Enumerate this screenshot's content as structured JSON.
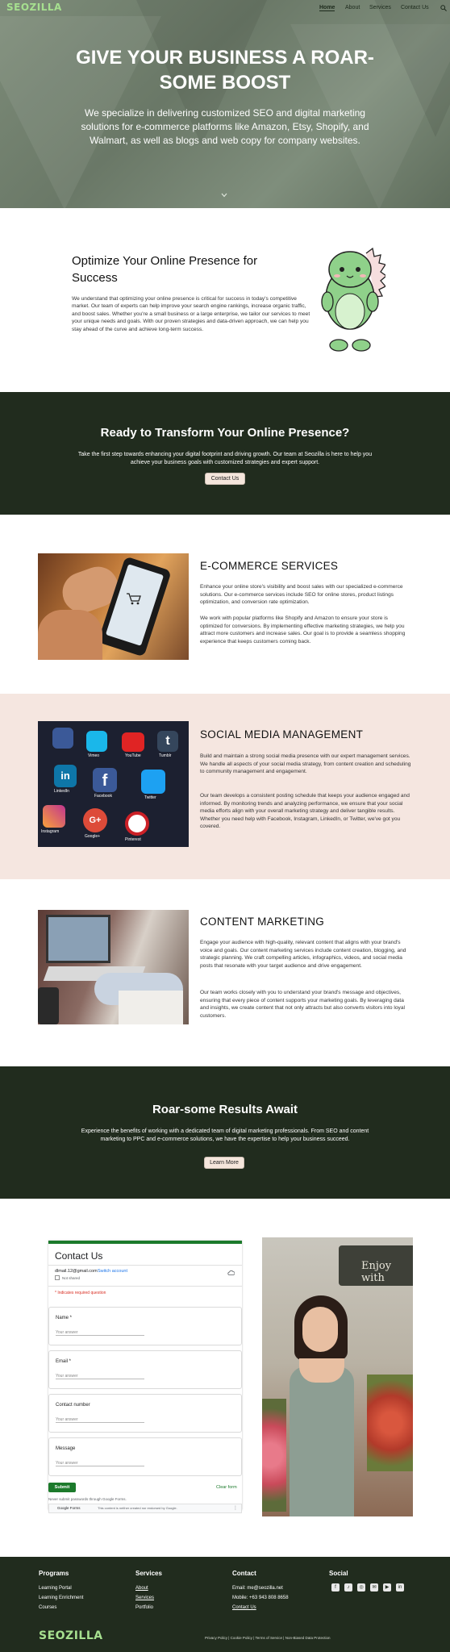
{
  "brand": {
    "logo_text": "SEOZILLA",
    "accent": "#a6e08f",
    "dark": "#212c1e",
    "cream": "#f5e6dc"
  },
  "nav": {
    "items": [
      "Home",
      "About",
      "Services",
      "Contact Us"
    ],
    "active": "Home",
    "search_icon": "search-icon"
  },
  "hero": {
    "title": "GIVE YOUR BUSINESS A ROAR-SOME BOOST",
    "subtitle": "We specialize in delivering customized SEO and digital marketing solutions for e-commerce platforms like Amazon, Etsy, Shopify, and Walmart, as well as blogs and web copy for company websites.",
    "scroll_icon": "chevron-down-icon"
  },
  "optimize": {
    "title": "Optimize Your Online Presence for Success",
    "text": "We understand that optimizing your online presence is critical for success in today's competitive market. Our team of experts can help improve your search engine rankings, increase organic traffic, and boost sales. Whether you're a small business or a large enterprise, we tailor our services to meet your unique needs and goals. With our proven strategies and data-driven approach, we can help you stay ahead of the curve and achieve long-term success."
  },
  "cta1": {
    "title": "Ready to Transform Your Online Presence?",
    "text": "Take the first step towards enhancing your digital footprint and driving growth. Our team at Seozilla is here to help you achieve your business goals with customized strategies and expert support.",
    "button": "Contact Us"
  },
  "services": [
    {
      "title": "E-COMMERCE SERVICES",
      "p1": "Enhance your online store's visibility and boost sales with our specialized e-commerce solutions. Our e-commerce services include SEO for online stores, product listings optimization, and conversion rate optimization.",
      "p2": "We work with popular platforms like Shopify and Amazon to ensure your store is optimized for conversions. By implementing effective marketing strategies, we help you attract more customers and increase sales. Our goal is to provide a seamless shopping experience that keeps customers coming back."
    },
    {
      "title": "SOCIAL MEDIA MANAGEMENT",
      "p1": "Build and maintain a strong social media presence with our expert management services. We handle all aspects of your social media strategy, from content creation and scheduling to community management and engagement.",
      "p2": "Our team develops a consistent posting schedule that keeps your audience engaged and informed. By monitoring trends and analyzing performance, we ensure that your social media efforts align with your overall marketing strategy and deliver tangible results. Whether you need help with Facebook, Instagram, LinkedIn, or Twitter, we've got you covered.",
      "app_labels": [
        "Vimeo",
        "YouTube",
        "Tumblr",
        "LinkedIn",
        "Facebook",
        "Twitter",
        "Instagram",
        "Google+",
        "Pinterest"
      ]
    },
    {
      "title": "CONTENT MARKETING",
      "p1": "Engage your audience with high-quality, relevant content that aligns with your brand's voice and goals. Our content marketing services include content creation, blogging, and strategic planning. We craft compelling articles, infographics, videos, and social media posts that resonate with your target audience and drive engagement.",
      "p2": "Our team works closely with you to understand your brand's message and objectives, ensuring that every piece of content supports your marketing goals. By leveraging data and insights, we create content that not only attracts but also converts visitors into loyal customers."
    }
  ],
  "cta2": {
    "title": "Roar-some Results Await",
    "text": "Experience the benefits of working with a dedicated team of digital marketing professionals. From SEO and content marketing to PPC and e-commerce solutions, we have the expertise to help your business succeed.",
    "button": "Learn More"
  },
  "form": {
    "title": "Contact Us",
    "account": "dlmail.12@gmail.com",
    "switch": "Switch account",
    "not_shared": "Not shared",
    "required_note": "* Indicates required question",
    "fields": [
      {
        "label": "Name *",
        "placeholder": "Your answer"
      },
      {
        "label": "Email *",
        "placeholder": "Your answer"
      },
      {
        "label": "Contact number",
        "placeholder": "Your answer"
      },
      {
        "label": "Message",
        "placeholder": "Your answer"
      }
    ],
    "submit": "Submit",
    "clear": "Clear form",
    "footer_note": "Never submit passwords through Google Forms.",
    "recaptcha_brand": "Google Forms",
    "recaptcha_text": "This content is neither created nor endorsed by Google."
  },
  "photo_sign": "Enjoy with",
  "footer": {
    "programs": {
      "title": "Programs",
      "items": [
        "Learning Portal",
        "Learning Enrichment",
        "Courses"
      ]
    },
    "services": {
      "title": "Services",
      "items": [
        "About",
        "Services",
        "Portfolio"
      ]
    },
    "contact": {
      "title": "Contact",
      "items": [
        "Email: me@seozilla.net",
        "Mobile: +63 943 808 8658",
        "Contact Us"
      ]
    },
    "social": {
      "title": "Social",
      "icons": [
        "facebook-icon",
        "tiktok-icon",
        "instagram-icon",
        "mail-icon",
        "youtube-icon",
        "linkedin-icon"
      ]
    },
    "logo_text": "SEOZILLA",
    "legal": "Privacy Policy | Cookie Policy | Terms of Service | Non-Biased Data Protection"
  }
}
